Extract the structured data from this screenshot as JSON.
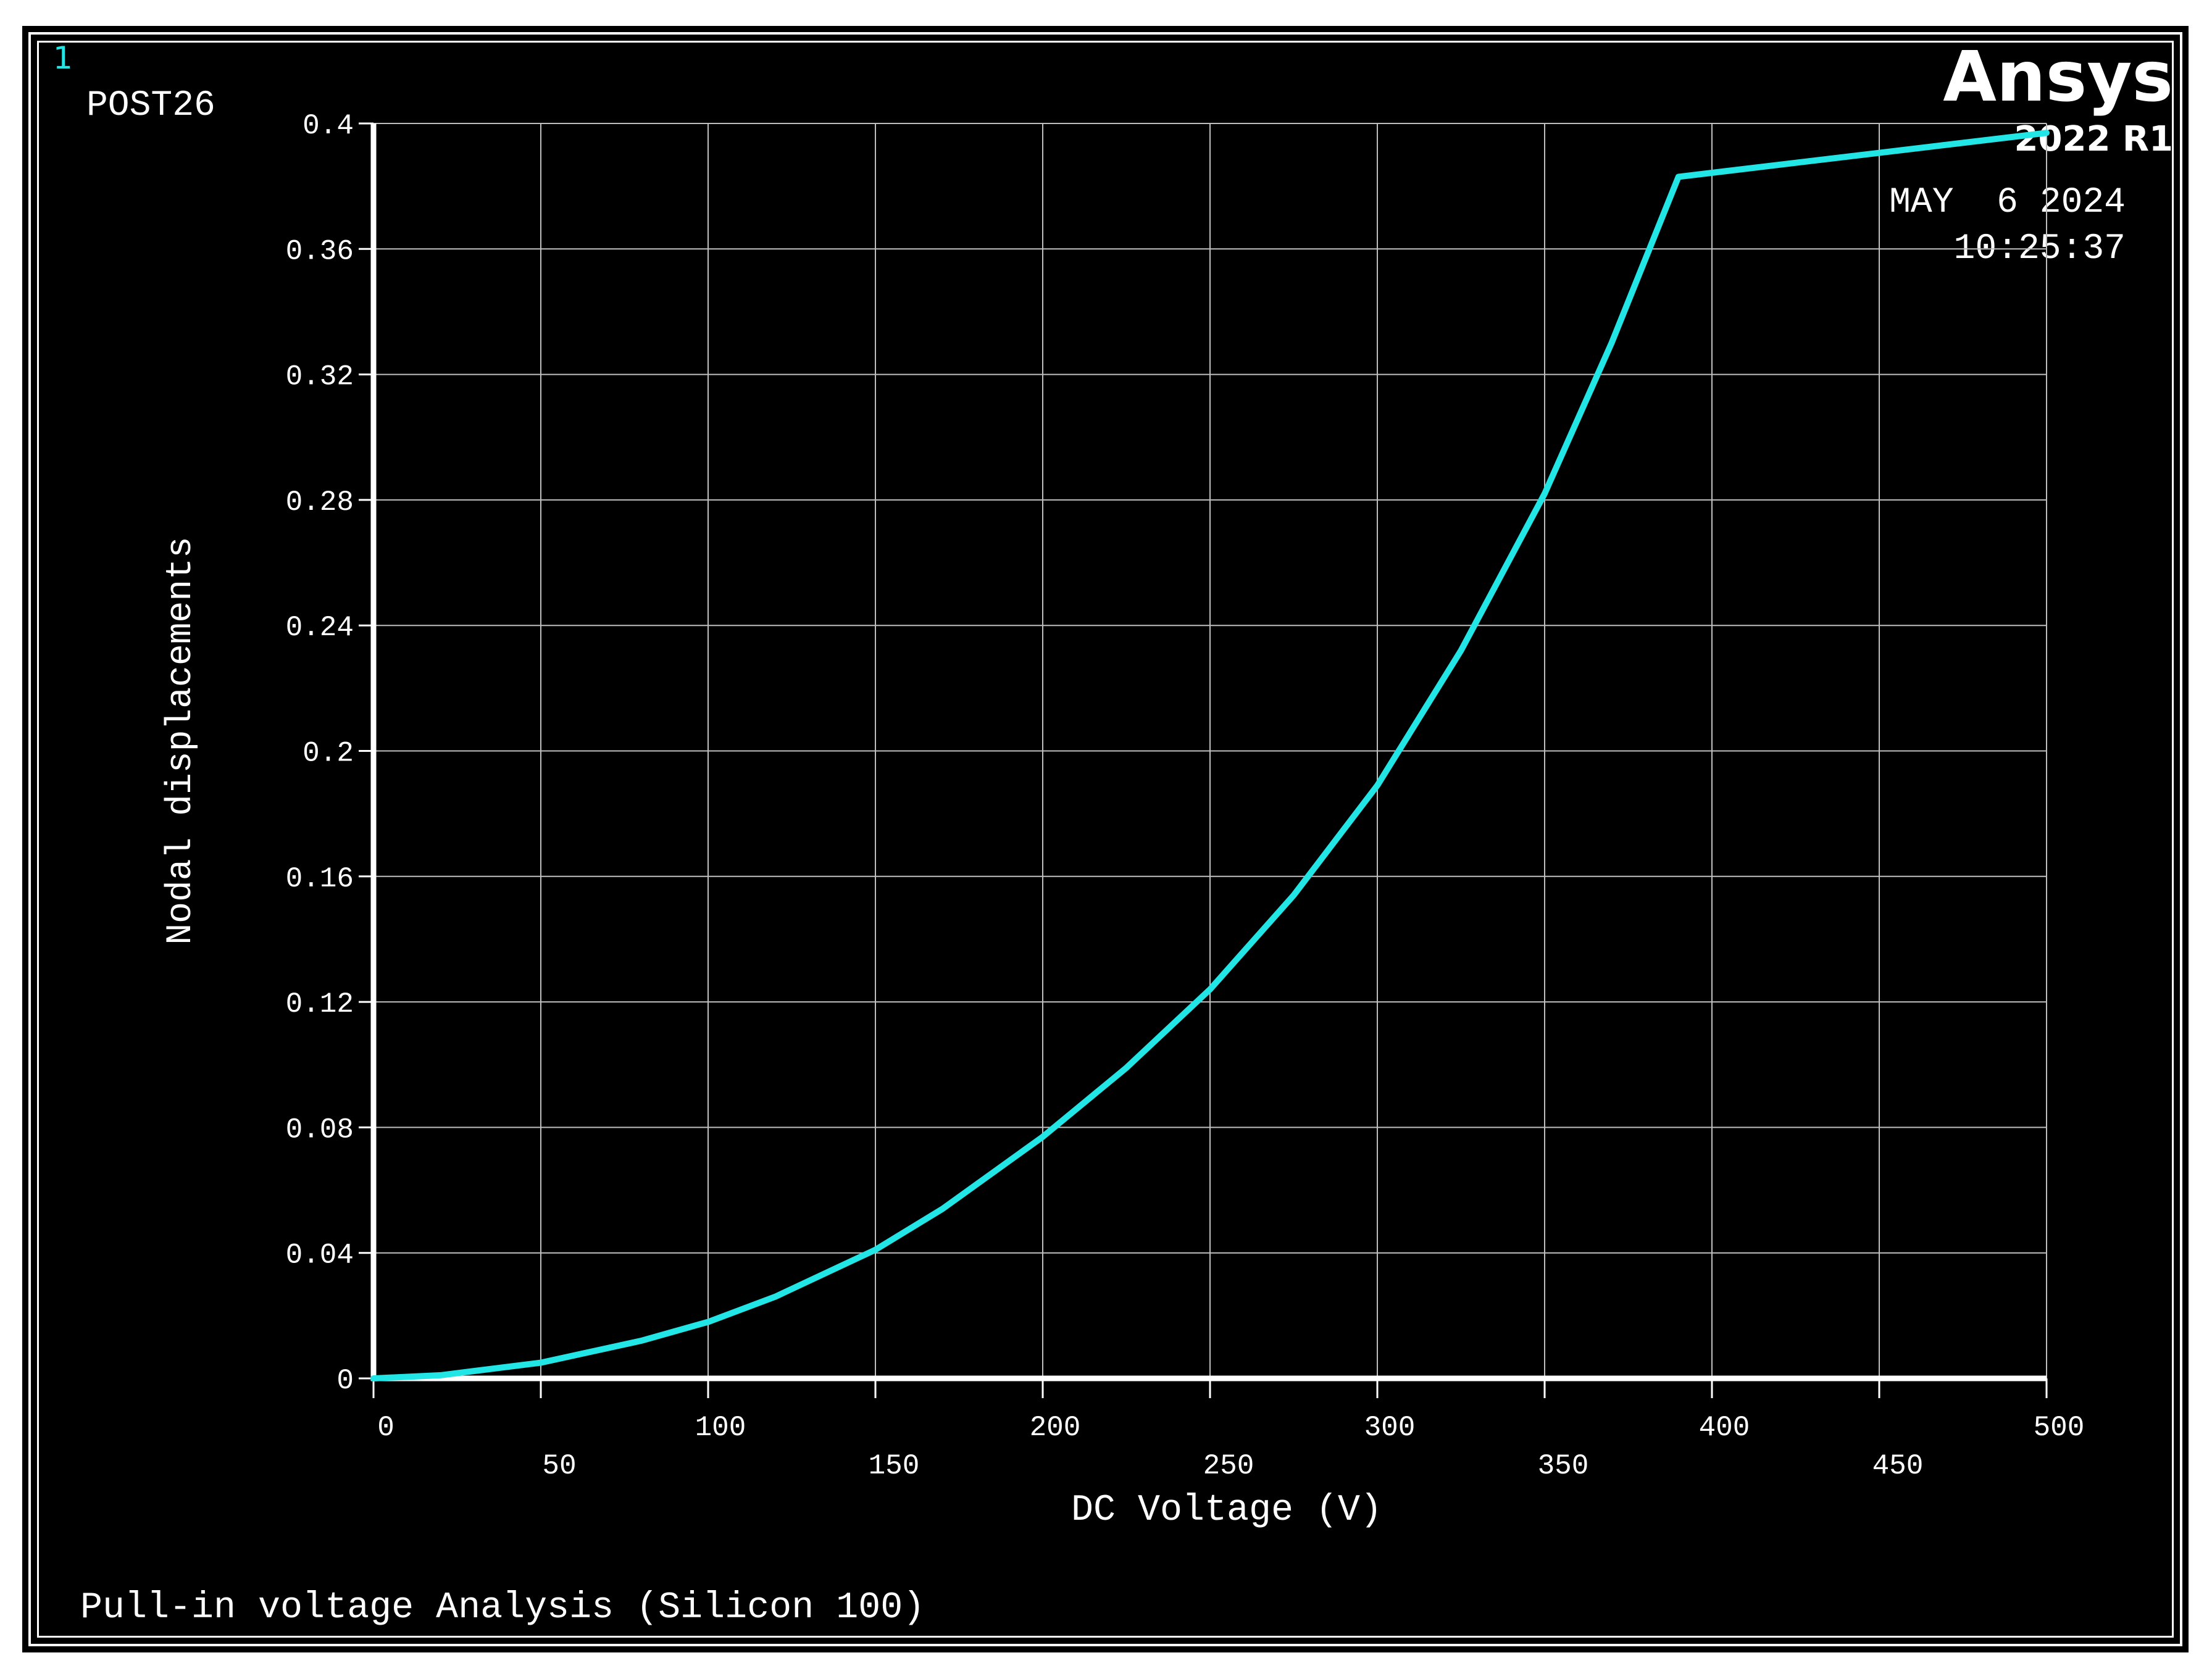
{
  "window_number": "1",
  "post_label": "POST26",
  "logo": {
    "brand": "Ansys",
    "version": "2022 R1"
  },
  "date": "MAY  6 2024",
  "time": "10:25:37",
  "footer_title": "Pull-in voltage Analysis (Silicon 100)",
  "colors": {
    "background": "#000000",
    "curve": "#22e5e5",
    "axis": "#ffffff",
    "grid": "#bfbfbf",
    "text": "#ffffff",
    "window_number": "#22e5e5"
  },
  "chart_data": {
    "type": "line",
    "xlabel": "DC Voltage (V)",
    "ylabel": "Nodal displacements",
    "xlim": [
      0,
      500
    ],
    "ylim": [
      0,
      0.4
    ],
    "x_ticks_upper": [
      "0",
      "100",
      "200",
      "300",
      "400",
      "500"
    ],
    "x_ticks_lower": [
      "50",
      "150",
      "250",
      "350",
      "450"
    ],
    "y_ticks": [
      "0",
      "0.04",
      "0.08",
      "0.12",
      "0.16",
      "0.2",
      "0.24",
      "0.28",
      "0.32",
      "0.36",
      "0.4"
    ],
    "grid": true,
    "series": [
      {
        "x": [
          0,
          20,
          50,
          80,
          100,
          120,
          150,
          170,
          200,
          225,
          250,
          275,
          300,
          325,
          350,
          370,
          390,
          500
        ],
        "y": [
          0,
          0.001,
          0.005,
          0.012,
          0.018,
          0.026,
          0.041,
          0.054,
          0.077,
          0.099,
          0.124,
          0.154,
          0.189,
          0.232,
          0.282,
          0.33,
          0.383,
          0.397
        ]
      }
    ]
  }
}
